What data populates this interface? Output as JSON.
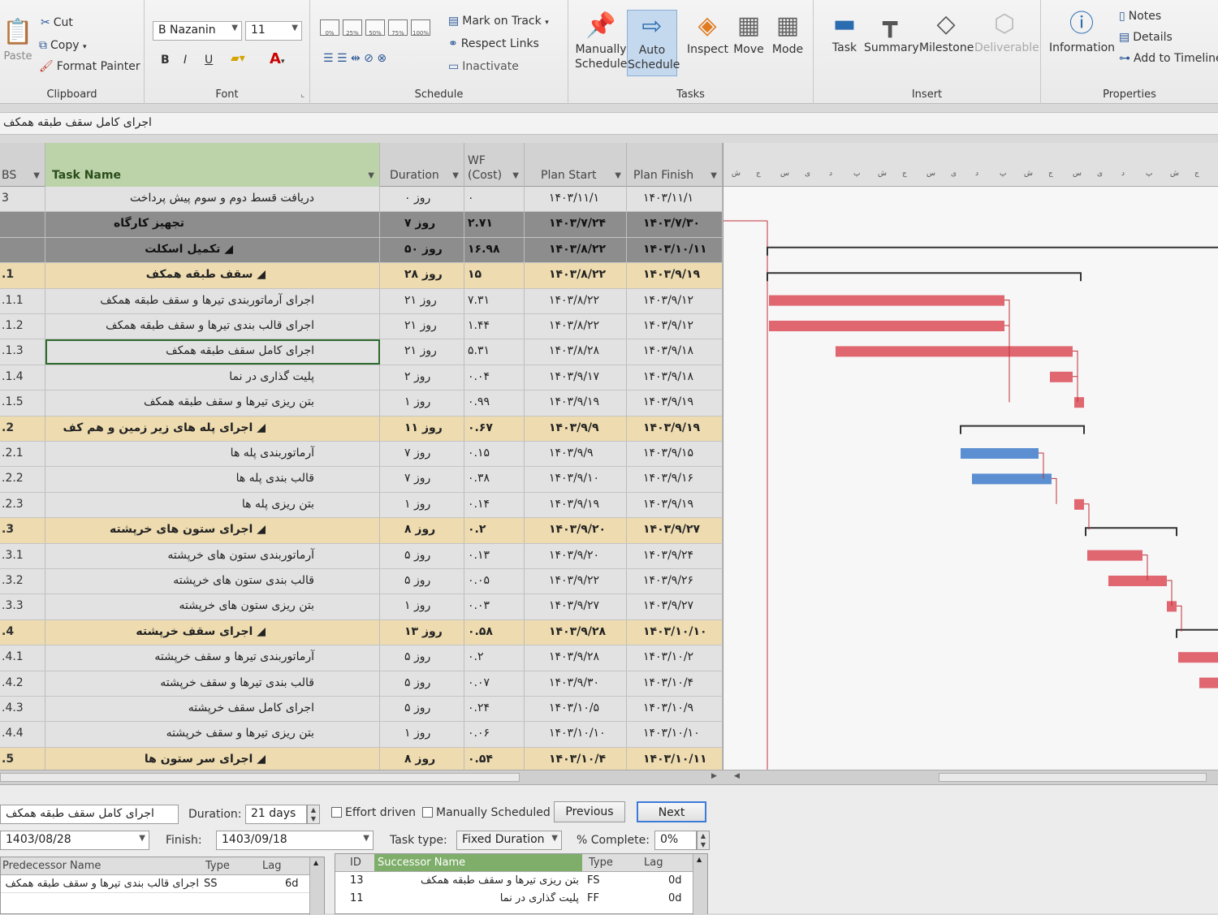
{
  "ribbon": {
    "clipboard": {
      "paste": "Paste",
      "cut": "Cut",
      "copy": "Copy",
      "format_painter": "Format Painter",
      "label": "Clipboard"
    },
    "font": {
      "family": "B Nazanin",
      "size": "11",
      "bold": "B",
      "italic": "I",
      "underline": "U",
      "label": "Font"
    },
    "schedule": {
      "pct": [
        "0%",
        "25%",
        "50%",
        "75%",
        "100%"
      ],
      "mark_on_track": "Mark on Track",
      "respect_links": "Respect Links",
      "inactivate": "Inactivate",
      "label": "Schedule"
    },
    "tasks": {
      "manually_schedule": [
        "Manually",
        "Schedule"
      ],
      "auto_schedule": [
        "Auto",
        "Schedule"
      ],
      "inspect": "Inspect",
      "move": "Move",
      "mode": "Mode",
      "label": "Tasks"
    },
    "insert": {
      "task": "Task",
      "summary": "Summary",
      "milestone": "Milestone",
      "deliverable": "Deliverable",
      "label": "Insert"
    },
    "properties": {
      "information": "Information",
      "notes": "Notes",
      "details": "Details",
      "add_to_timeline": "Add to Timeline",
      "label": "Properties"
    }
  },
  "entry_bar": {
    "value": "اجرای کامل سقف طبقه همکف"
  },
  "grid": {
    "headers": {
      "wbs": "BS",
      "task_name": "Task Name",
      "duration": "Duration",
      "wf_cost_1": "WF",
      "wf_cost_2": "(Cost)",
      "plan_start": "Plan Start",
      "plan_finish": "Plan Finish"
    },
    "rows": [
      {
        "wbs": "3",
        "name": "دریافت قسط دوم و سوم پیش پرداخت",
        "duration": "۰ روز",
        "cost": "۰",
        "start": "۱۴۰۳/۱۱/۱",
        "finish": "۱۴۰۳/۱۱/۱"
      },
      {
        "wbs": "",
        "name": "تجهیز کارگاه",
        "duration": "۷ روز",
        "cost": "۲.۷۱",
        "start": "۱۴۰۳/۷/۲۴",
        "finish": "۱۴۰۳/۷/۳۰"
      },
      {
        "wbs": "",
        "name": "◢ تکمیل اسکلت",
        "duration": "۵۰ روز",
        "cost": "۱۶.۹۸",
        "start": "۱۴۰۳/۸/۲۲",
        "finish": "۱۴۰۳/۱۰/۱۱"
      },
      {
        "wbs": ".1",
        "name": "◢ سقف طبقه همکف",
        "duration": "۲۸ روز",
        "cost": "۱۵",
        "start": "۱۴۰۳/۸/۲۲",
        "finish": "۱۴۰۳/۹/۱۹"
      },
      {
        "wbs": ".1.1",
        "name": "اجرای آرماتوربندی تیرها و سقف طبقه همکف",
        "duration": "۲۱ روز",
        "cost": "۷.۳۱",
        "start": "۱۴۰۳/۸/۲۲",
        "finish": "۱۴۰۳/۹/۱۲"
      },
      {
        "wbs": ".1.2",
        "name": "اجرای قالب بندی تیرها و سقف طبقه همکف",
        "duration": "۲۱ روز",
        "cost": "۱.۴۴",
        "start": "۱۴۰۳/۸/۲۲",
        "finish": "۱۴۰۳/۹/۱۲"
      },
      {
        "wbs": ".1.3",
        "name": "اجرای کامل سقف طبقه همکف",
        "duration": "۲۱ روز",
        "cost": "۵.۳۱",
        "start": "۱۴۰۳/۸/۲۸",
        "finish": "۱۴۰۳/۹/۱۸"
      },
      {
        "wbs": ".1.4",
        "name": "پلیت گذاری در نما",
        "duration": "۲ روز",
        "cost": "۰.۰۴",
        "start": "۱۴۰۳/۹/۱۷",
        "finish": "۱۴۰۳/۹/۱۸"
      },
      {
        "wbs": ".1.5",
        "name": "بتن ریزی تیرها و سقف طبقه همکف",
        "duration": "۱ روز",
        "cost": "۰.۹۹",
        "start": "۱۴۰۳/۹/۱۹",
        "finish": "۱۴۰۳/۹/۱۹"
      },
      {
        "wbs": ".2",
        "name": "◢ اجرای پله های زیر زمین و هم کف",
        "duration": "۱۱ روز",
        "cost": "۰.۶۷",
        "start": "۱۴۰۳/۹/۹",
        "finish": "۱۴۰۳/۹/۱۹"
      },
      {
        "wbs": ".2.1",
        "name": "آرماتوربندی پله ها",
        "duration": "۷ روز",
        "cost": "۰.۱۵",
        "start": "۱۴۰۳/۹/۹",
        "finish": "۱۴۰۳/۹/۱۵"
      },
      {
        "wbs": ".2.2",
        "name": "قالب بندی پله ها",
        "duration": "۷ روز",
        "cost": "۰.۳۸",
        "start": "۱۴۰۳/۹/۱۰",
        "finish": "۱۴۰۳/۹/۱۶"
      },
      {
        "wbs": ".2.3",
        "name": "بتن ریزی پله ها",
        "duration": "۱ روز",
        "cost": "۰.۱۴",
        "start": "۱۴۰۳/۹/۱۹",
        "finish": "۱۴۰۳/۹/۱۹"
      },
      {
        "wbs": ".3",
        "name": "◢ اجرای ستون های خرپشته",
        "duration": "۸ روز",
        "cost": "۰.۲",
        "start": "۱۴۰۳/۹/۲۰",
        "finish": "۱۴۰۳/۹/۲۷"
      },
      {
        "wbs": ".3.1",
        "name": "آرماتوربندی ستون های خرپشته",
        "duration": "۵ روز",
        "cost": "۰.۱۳",
        "start": "۱۴۰۳/۹/۲۰",
        "finish": "۱۴۰۳/۹/۲۴"
      },
      {
        "wbs": ".3.2",
        "name": "قالب بندی ستون های خرپشته",
        "duration": "۵ روز",
        "cost": "۰.۰۵",
        "start": "۱۴۰۳/۹/۲۲",
        "finish": "۱۴۰۳/۹/۲۶"
      },
      {
        "wbs": ".3.3",
        "name": "بتن ریزی ستون های خرپشته",
        "duration": "۱ روز",
        "cost": "۰.۰۳",
        "start": "۱۴۰۳/۹/۲۷",
        "finish": "۱۴۰۳/۹/۲۷"
      },
      {
        "wbs": ".4",
        "name": "◢ اجرای سقف خرپشته",
        "duration": "۱۳ روز",
        "cost": "۰.۵۸",
        "start": "۱۴۰۳/۹/۲۸",
        "finish": "۱۴۰۳/۱۰/۱۰"
      },
      {
        "wbs": ".4.1",
        "name": "آرماتوربندی تیرها و سقف خرپشته",
        "duration": "۵ روز",
        "cost": "۰.۲",
        "start": "۱۴۰۳/۹/۲۸",
        "finish": "۱۴۰۳/۱۰/۲"
      },
      {
        "wbs": ".4.2",
        "name": "قالب بندی تیرها و سقف خرپشته",
        "duration": "۵ روز",
        "cost": "۰.۰۷",
        "start": "۱۴۰۳/۹/۳۰",
        "finish": "۱۴۰۳/۱۰/۴"
      },
      {
        "wbs": ".4.3",
        "name": "اجرای کامل سقف خرپشته",
        "duration": "۵ روز",
        "cost": "۰.۲۴",
        "start": "۱۴۰۳/۱۰/۵",
        "finish": "۱۴۰۳/۱۰/۹"
      },
      {
        "wbs": ".4.4",
        "name": "بتن ریزی تیرها و سقف خرپشته",
        "duration": "۱ روز",
        "cost": "۰.۰۶",
        "start": "۱۴۰۳/۱۰/۱۰",
        "finish": "۱۴۰۳/۱۰/۱۰"
      },
      {
        "wbs": ".5",
        "name": "◢ اجرای سر ستون ها",
        "duration": "۸ روز",
        "cost": "۰.۵۴",
        "start": "۱۴۰۳/۱۰/۴",
        "finish": "۱۴۰۳/۱۰/۱۱"
      }
    ]
  },
  "gantt": {
    "ticks": [
      "ش",
      "ج",
      "س",
      "ی",
      "د",
      "پ",
      "ش",
      "ج",
      "س",
      "ی",
      "د",
      "پ",
      "ش",
      "ج",
      "س",
      "ی",
      "د",
      "پ",
      "ش",
      "ج"
    ],
    "colors": {
      "critical": "#e06670",
      "normal": "#5b8fd1",
      "summary": "#333333",
      "link": "#c0303a"
    }
  },
  "form": {
    "name_value": "اجرای کامل سقف طبقه همکف",
    "duration_label": "Duration:",
    "duration_value": "21 days",
    "effort_driven": "Effort driven",
    "manually_scheduled": "Manually Scheduled",
    "previous": "Previous",
    "next": "Next",
    "start_value": "1403/08/28",
    "finish_label": "Finish:",
    "finish_value": "1403/09/18",
    "task_type_label": "Task type:",
    "task_type_value": "Fixed Duration",
    "pct_complete_label": "% Complete:",
    "pct_complete_value": "0%",
    "predecessors": {
      "headers": {
        "name": "Predecessor Name",
        "type": "Type",
        "lag": "Lag"
      },
      "rows": [
        {
          "name": "اجرای قالب بندی تیرها و سقف طبقه همکف",
          "type": "SS",
          "lag": "6d"
        }
      ]
    },
    "successors": {
      "headers": {
        "id": "ID",
        "name": "Successor Name",
        "type": "Type",
        "lag": "Lag"
      },
      "rows": [
        {
          "id": "13",
          "name": "بتن ریزی تیرها و سقف طبقه همکف",
          "type": "FS",
          "lag": "0d"
        },
        {
          "id": "11",
          "name": "پلیت گذاری در نما",
          "type": "FF",
          "lag": "0d"
        }
      ]
    }
  }
}
